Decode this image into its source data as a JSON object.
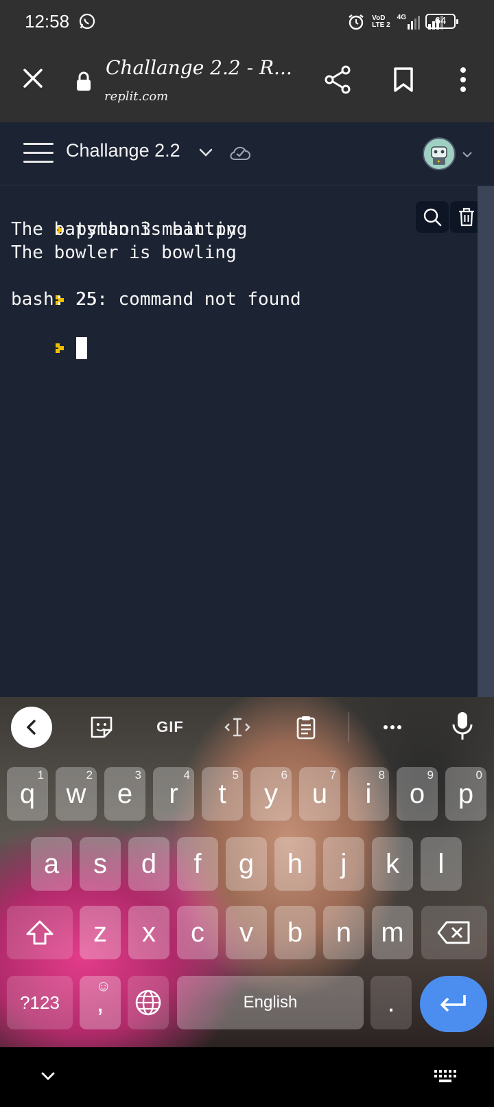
{
  "status_bar": {
    "time": "12:58",
    "network_line1": "VoD",
    "network_line2": "LTE 2",
    "network_type": "4G",
    "battery": "64"
  },
  "browser": {
    "page_title": "Challange 2.2 - R...",
    "url": "replit.com"
  },
  "replit_header": {
    "repl_name": "Challange 2.2"
  },
  "console": {
    "lines": [
      {
        "prompt": true,
        "text": "python3 main.py"
      },
      {
        "prompt": false,
        "text": "The batsman is batting"
      },
      {
        "prompt": false,
        "text": "The bowler is bowling"
      },
      {
        "prompt": true,
        "text": "25"
      },
      {
        "prompt": false,
        "text": "bash: 25: command not found"
      }
    ],
    "prompt_color": "#f0c000"
  },
  "keyboard": {
    "toolbar": {
      "gif_label": "GIF"
    },
    "row1": [
      {
        "key": "q",
        "hint": "1"
      },
      {
        "key": "w",
        "hint": "2"
      },
      {
        "key": "e",
        "hint": "3"
      },
      {
        "key": "r",
        "hint": "4"
      },
      {
        "key": "t",
        "hint": "5"
      },
      {
        "key": "y",
        "hint": "6"
      },
      {
        "key": "u",
        "hint": "7"
      },
      {
        "key": "i",
        "hint": "8"
      },
      {
        "key": "o",
        "hint": "9"
      },
      {
        "key": "p",
        "hint": "0"
      }
    ],
    "row2": [
      "a",
      "s",
      "d",
      "f",
      "g",
      "h",
      "j",
      "k",
      "l"
    ],
    "row3": [
      "z",
      "x",
      "c",
      "v",
      "b",
      "n",
      "m"
    ],
    "symbols_label": "?123",
    "comma_label": ",",
    "emoji_hint": "☺",
    "space_label": "English",
    "period_label": ".",
    "accent_color": "#4c8ef0"
  }
}
